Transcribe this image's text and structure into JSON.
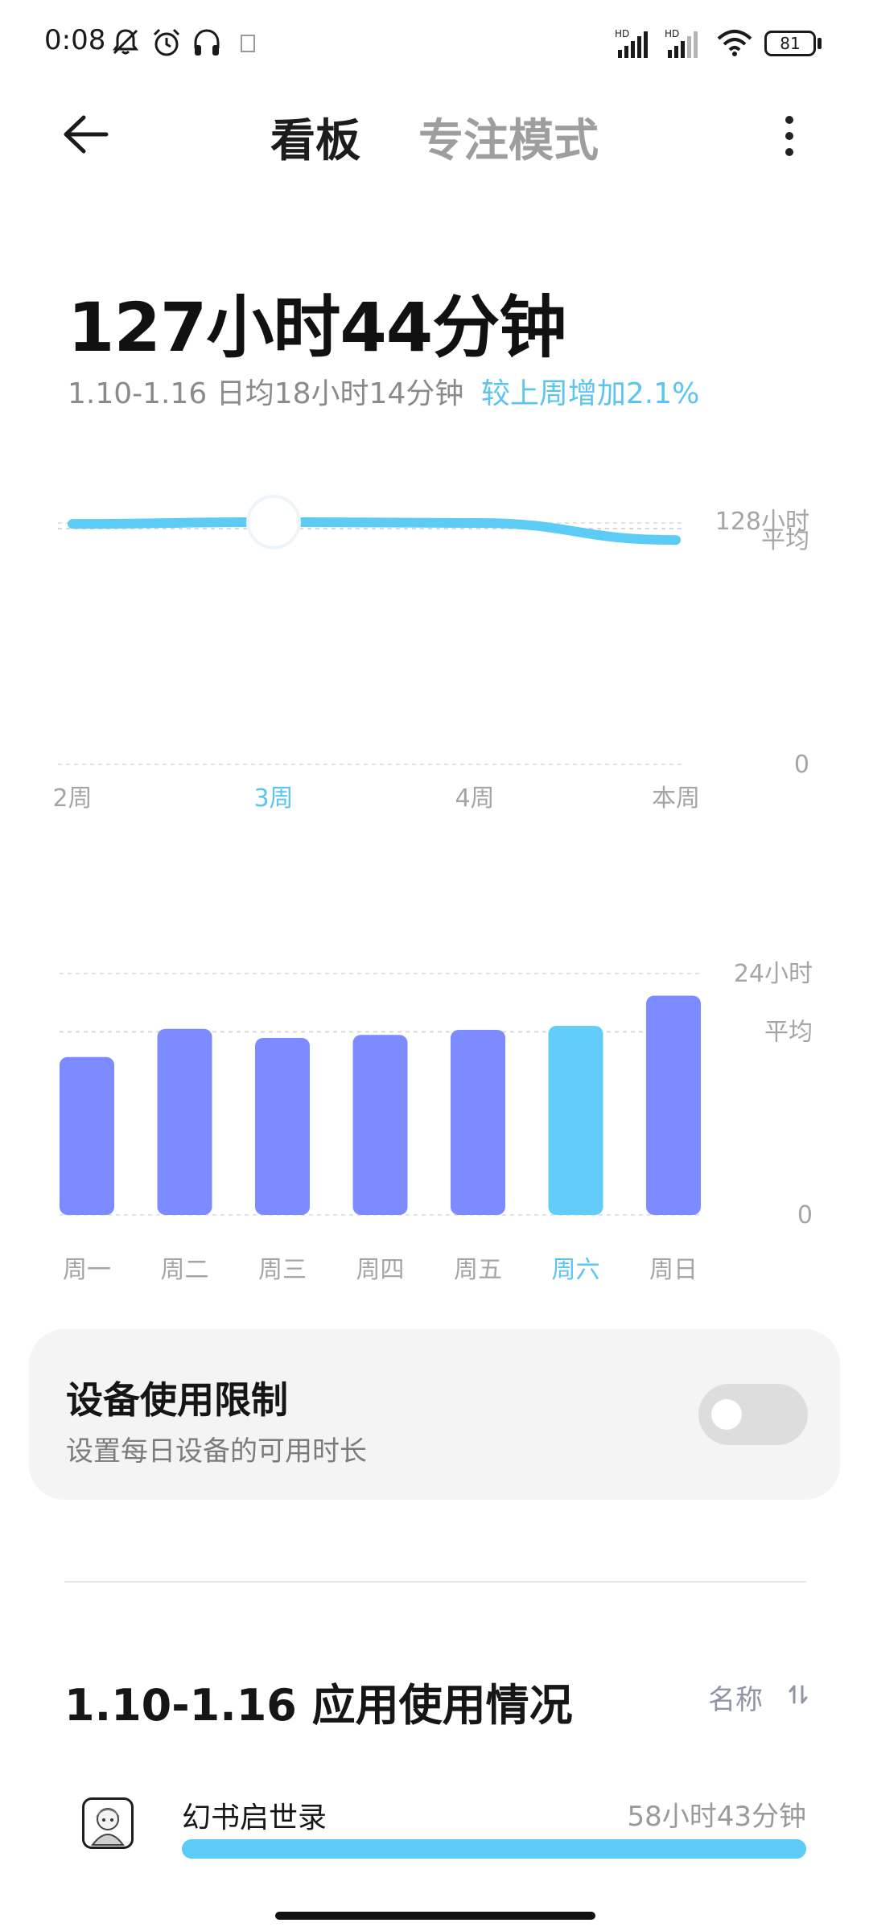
{
  "status_bar": {
    "time": "0:08",
    "battery": "81",
    "icons": [
      "mute-bell-icon",
      "alarm-icon",
      "headphones-icon",
      "notification-icon",
      "signal-hd-icon",
      "signal-hd-icon",
      "wifi-icon",
      "battery-icon"
    ]
  },
  "nav": {
    "tab_dashboard": "看板",
    "tab_focus": "专注模式"
  },
  "summary": {
    "total": "127小时44分钟",
    "range_avg": "1.10-1.16 日均18小时14分钟",
    "change": "较上周增加2.1%"
  },
  "weekly": {
    "y_top": "128小时",
    "y_avg": "平均",
    "y_zero": "0",
    "labels": [
      "2周",
      "3周",
      "4周",
      "本周"
    ],
    "selected_index": 1,
    "values": [
      127.5,
      128.5,
      128,
      119
    ],
    "ymax": 128,
    "average": 125,
    "colors": {
      "line": "#5ccbf5",
      "selected": "#5bc4ef",
      "axis": "#a5a5a5"
    }
  },
  "chart_data": {
    "type": "bar",
    "categories": [
      "周一",
      "周二",
      "周三",
      "周四",
      "周五",
      "周六",
      "周日"
    ],
    "values": [
      15.7,
      18.5,
      17.6,
      17.9,
      18.4,
      18.8,
      21.8
    ],
    "ylim": [
      0,
      24
    ],
    "y_top_label": "24小时",
    "y_avg_label": "平均",
    "y_zero_label": "0",
    "average": 18.2,
    "highlight_index": 5,
    "colors": {
      "bar": "#7c8bff",
      "highlight": "#63cdfa"
    }
  },
  "limit": {
    "title": "设备使用限制",
    "subtitle": "设置每日设备的可用时长",
    "enabled": false
  },
  "usage": {
    "title": "1.10-1.16 应用使用情况",
    "sort_label": "名称",
    "apps": [
      {
        "name": "幻书启世录",
        "time": "58小时43分钟",
        "share": 1.0
      }
    ]
  }
}
